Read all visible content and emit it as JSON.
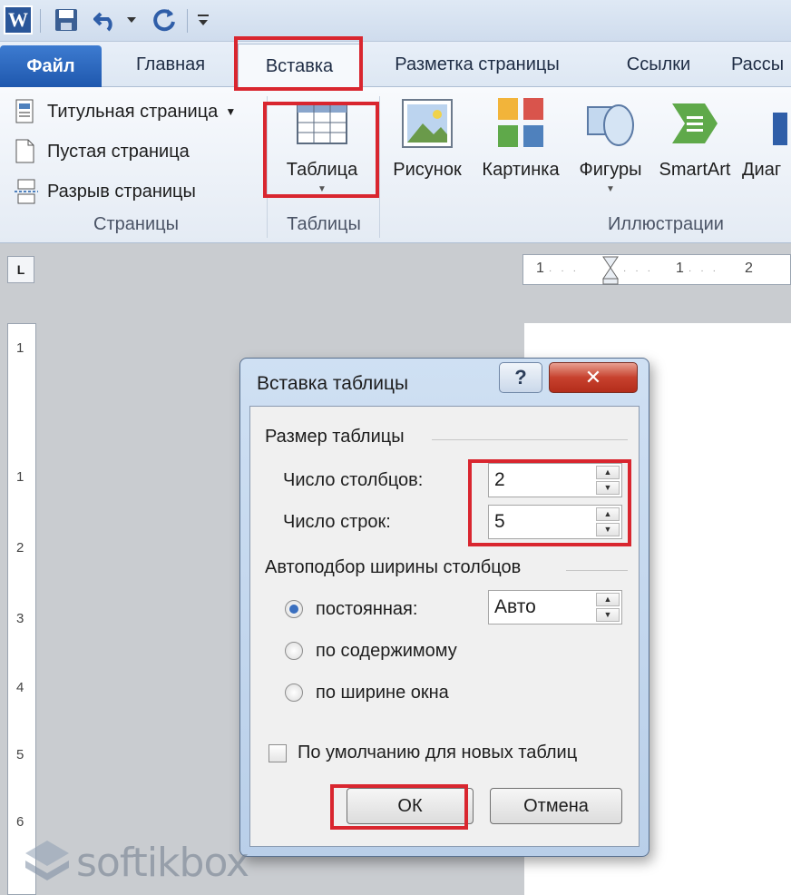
{
  "quick_access": {
    "app_letter": "W",
    "icons": [
      "word-icon",
      "save-icon",
      "undo-icon",
      "undo-dropdown-icon",
      "redo-icon",
      "customize-qat-icon"
    ]
  },
  "tabs": [
    {
      "label": "Файл"
    },
    {
      "label": "Главная"
    },
    {
      "label": "Вставка"
    },
    {
      "label": "Разметка страницы"
    },
    {
      "label": "Ссылки"
    },
    {
      "label": "Рассы"
    }
  ],
  "ribbon": {
    "pages": {
      "items": [
        "Титульная страница",
        "Пустая страница",
        "Разрыв страницы"
      ],
      "group_label": "Страницы"
    },
    "tables": {
      "button_label": "Таблица",
      "group_label": "Таблицы"
    },
    "illustrations": {
      "buttons": [
        "Рисунок",
        "Картинка",
        "Фигуры",
        "SmartArt",
        "Диаг"
      ],
      "group_label": "Иллюстрации"
    }
  },
  "rulers": {
    "horizontal_labels": [
      "1",
      "1",
      "2"
    ],
    "vertical_labels": [
      "1",
      "1",
      "2",
      "3",
      "4",
      "5",
      "6"
    ],
    "tab_selector": "L"
  },
  "dialog": {
    "title": "Вставка таблицы",
    "help": "?",
    "close": "✕",
    "size_section": "Размер таблицы",
    "columns_label": "Число столбцов:",
    "columns_value": "2",
    "rows_label": "Число строк:",
    "rows_value": "5",
    "autofit_section": "Автоподбор ширины столбцов",
    "fixed_label": "постоянная:",
    "fixed_value": "Авто",
    "content_label": "по содержимому",
    "window_label": "по ширине окна",
    "autofit_selected": "постоянная:",
    "default_checkbox": "По умолчанию для новых таблиц",
    "ok": "ОК",
    "cancel": "Отмена"
  },
  "watermark": "softikbox",
  "colors": {
    "highlight": "#d9262f",
    "file_tab": "#2a64bb",
    "close_button": "#c7412e"
  }
}
